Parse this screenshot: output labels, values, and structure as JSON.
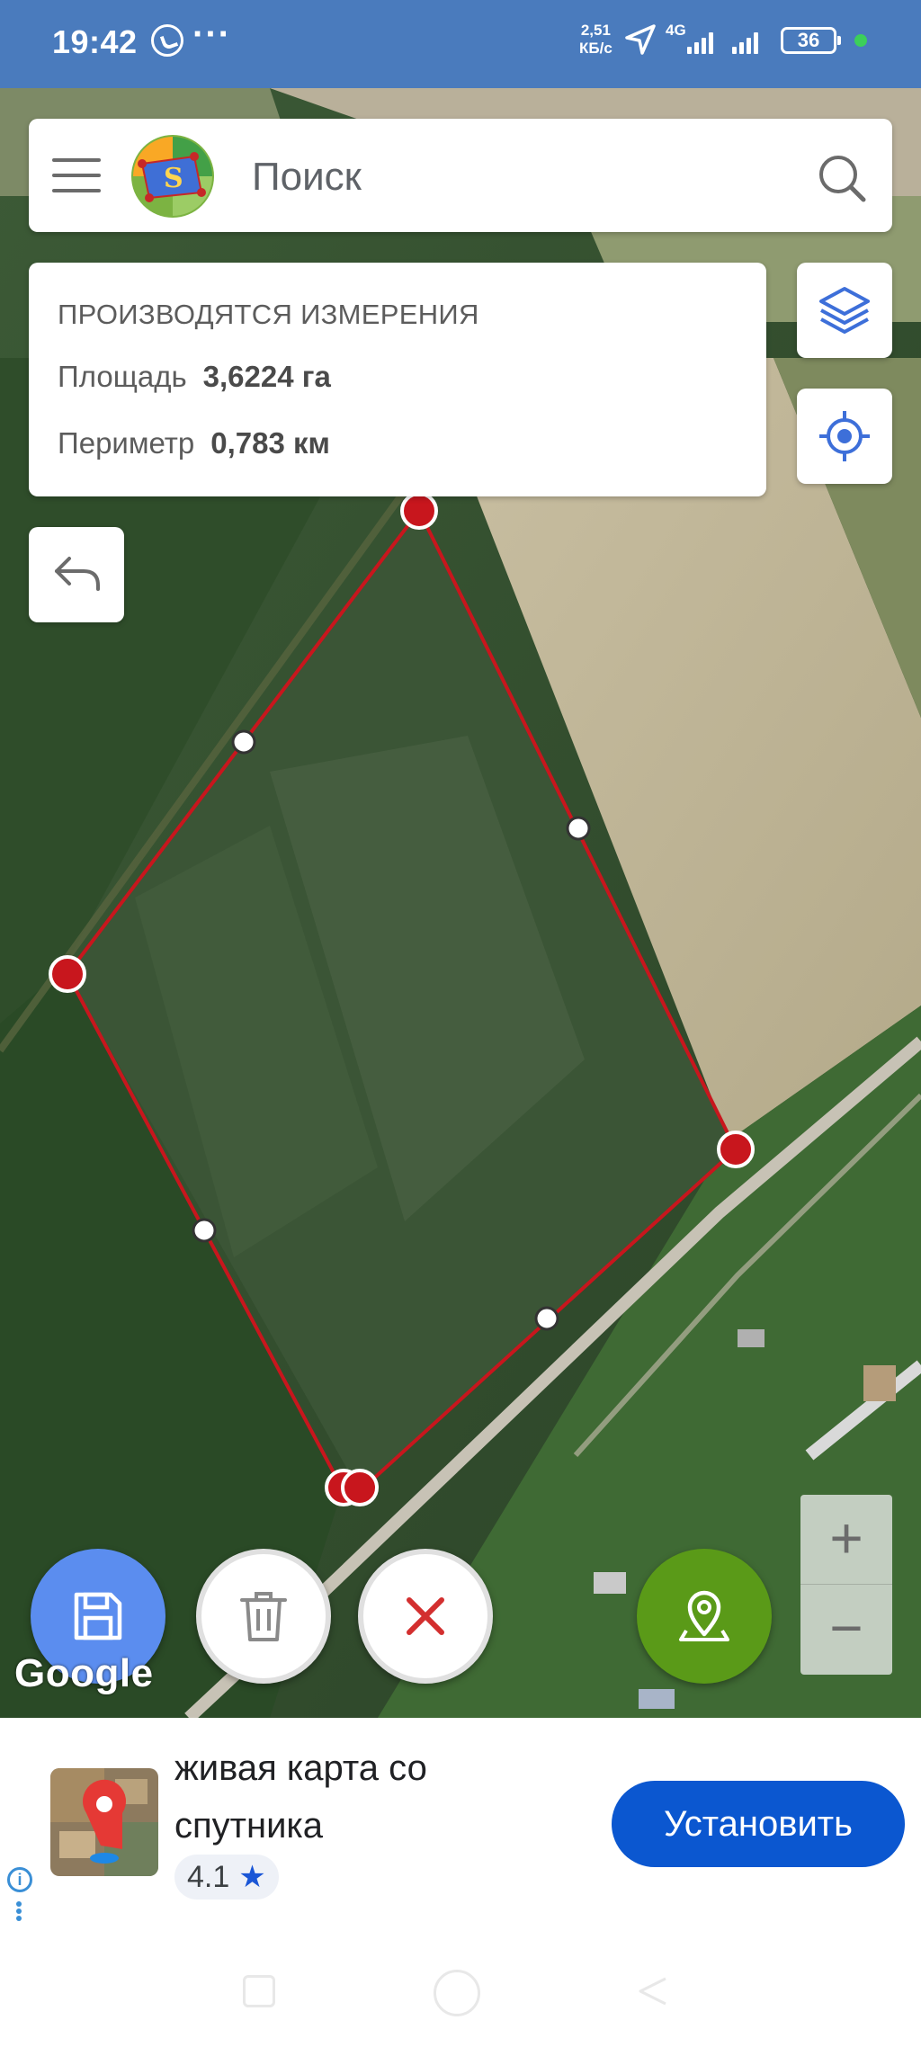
{
  "status_bar": {
    "time": "19:42",
    "speed_value": "2,51",
    "speed_unit": "КБ/с",
    "network": "4G",
    "battery": "36",
    "icons": [
      "whatsapp-icon",
      "more-dots-icon",
      "location-arrow-icon",
      "signal-icon",
      "battery-icon"
    ]
  },
  "search": {
    "placeholder": "Поиск",
    "icons": [
      "menu-icon",
      "app-logo",
      "search-icon"
    ]
  },
  "measurement": {
    "title": "ПРОИЗВОДЯТСЯ ИЗМЕРЕНИЯ",
    "area_label": "Площадь",
    "area_value": "3,6224 га",
    "perimeter_label": "Периметр",
    "perimeter_value": "0,783 км"
  },
  "map_controls": {
    "layers_icon": "layers-icon",
    "locate_icon": "my-location-icon",
    "undo_icon": "undo-icon",
    "zoom_in": "+",
    "zoom_out": "−"
  },
  "actions": {
    "save_icon": "save-icon",
    "delete_icon": "trash-icon",
    "cancel_icon": "close-icon",
    "add_point_icon": "add-point-icon"
  },
  "attribution": "Google",
  "colors": {
    "status_bar": "#4a7bbd",
    "polygon": "#c8161d",
    "save_button": "#5b8def",
    "point_button": "#5a9a18",
    "install_button": "#0b57d0"
  },
  "ad": {
    "title": "живая карта со спутника",
    "rating": "4.1",
    "install_label": "Установить"
  }
}
